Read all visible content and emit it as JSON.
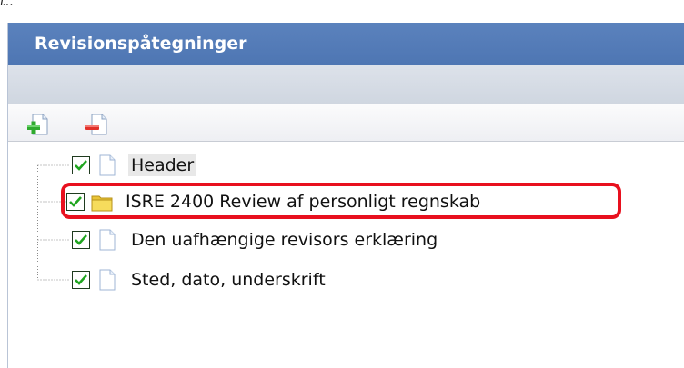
{
  "top_fragment": "t..",
  "panel": {
    "title": "Revisionspåtegninger"
  },
  "toolbar": {
    "add_icon": "add-document-icon",
    "remove_icon": "remove-document-icon"
  },
  "tree": {
    "nodes": [
      {
        "label": "Header",
        "checked": true,
        "icon": "document-icon"
      },
      {
        "label": "ISRE 2400 Review af personligt regnskab",
        "checked": true,
        "icon": "folder-icon",
        "selected": true
      },
      {
        "label": "Den uafhængige revisors erklæring",
        "checked": true,
        "icon": "document-icon"
      },
      {
        "label": "Sted, dato, underskrift",
        "checked": true,
        "icon": "document-icon"
      }
    ]
  },
  "colors": {
    "title_bar": "#5b82bd",
    "highlight": "#e8101e",
    "check": "#1fa51f"
  }
}
